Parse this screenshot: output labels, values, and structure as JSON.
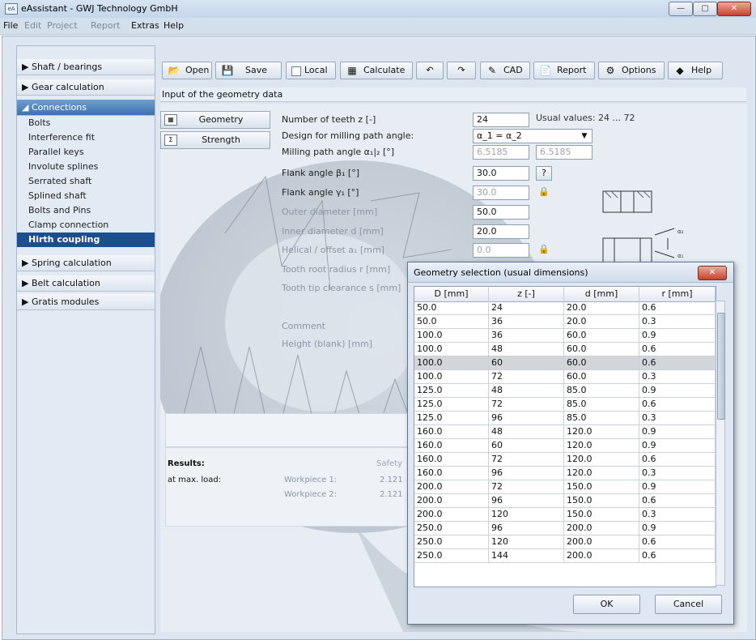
{
  "window": {
    "title": "eAssistant - GWJ Technology GmbH",
    "app_icon": "eA",
    "minimize_glyph": "—",
    "maximize_glyph": "▢",
    "close_glyph": "✕"
  },
  "menu": [
    {
      "label": "File",
      "enabled": true
    },
    {
      "label": "Edit",
      "enabled": false
    },
    {
      "label": "Project",
      "enabled": false
    },
    {
      "label": "Report",
      "enabled": false
    },
    {
      "label": "Extras",
      "enabled": true
    },
    {
      "label": "Help",
      "enabled": true
    }
  ],
  "sidebar": {
    "groups": [
      {
        "label": "▶ Shaft / bearings"
      },
      {
        "label": "▶ Gear calculation"
      },
      {
        "label": "◢ Connections"
      },
      {
        "label": "▶ Spring calculation"
      },
      {
        "label": "▶ Belt calculation"
      },
      {
        "label": "▶ Gratis modules"
      }
    ],
    "connection_items": [
      {
        "label": "Bolts"
      },
      {
        "label": "Interference fit"
      },
      {
        "label": "Parallel keys"
      },
      {
        "label": "Involute splines"
      },
      {
        "label": "Serrated shaft"
      },
      {
        "label": "Splined shaft"
      },
      {
        "label": "Bolts and Pins"
      },
      {
        "label": "Clamp connection"
      },
      {
        "label": "Hirth coupling",
        "selected": true
      }
    ]
  },
  "toolbar": {
    "open": "Open",
    "save": "Save",
    "local": "Local",
    "calculate": "Calculate",
    "undo_glyph": "↶",
    "redo_glyph": "↷",
    "cad": "CAD",
    "report": "Report",
    "options": "Options",
    "help": "Help",
    "icons": {
      "open": "📂",
      "save": "💾",
      "calculate": "▦",
      "cad": "✎",
      "report": "📄",
      "options": "⚙",
      "help": "◆"
    }
  },
  "section_title": "Input of the geometry data",
  "tabs": {
    "geometry": "Geometry",
    "strength": "Strength",
    "geometry_icon": "▦",
    "strength_icon": "Σ"
  },
  "form": {
    "teeth_label": "Number of teeth z [-]",
    "teeth_value": "24",
    "usual_values": "Usual values: 24 ... 72",
    "design_label": "Design for milling path angle:",
    "design_value": "α_1 = α_2",
    "milling_label": "Milling path angle α₁|₂ [°]",
    "milling_value_1": "6.5185",
    "milling_value_2": "6.5185",
    "flank_beta_label": "Flank angle β₁ [°]",
    "flank_beta_value": "30.0",
    "flank_gamma_label": "Flank angle γ₁ [°]",
    "flank_gamma_value": "30.0",
    "outer_label": "Outer diameter [mm]",
    "outer_value": "50.0",
    "inner_label": "Inner diameter d [mm]",
    "inner_value": "20.0",
    "helical_label": "Helical / offset a₁ [mm]",
    "helical_value": "0.0",
    "root_label": "Tooth root radius r [mm]",
    "tip_label": "Tooth tip clearance s [mm]",
    "comment_label": "Comment",
    "height_label": "Height (blank) [mm]",
    "question_glyph": "?",
    "lock_glyph": "🔒"
  },
  "results": {
    "label": "Results:",
    "max_load": "at max. load:",
    "safety": "Safety",
    "workpiece1": "Workpiece 1:",
    "workpiece2": "Workpiece 2:",
    "wp1_value": "2.121",
    "wp2_value": "2.121"
  },
  "dialog": {
    "title": "Geometry selection (usual dimensions)",
    "close_glyph": "✕",
    "columns": [
      "D [mm]",
      "z [-]",
      "d [mm]",
      "r [mm]"
    ],
    "rows": [
      [
        "50.0",
        "24",
        "20.0",
        "0.6"
      ],
      [
        "50.0",
        "36",
        "20.0",
        "0.3"
      ],
      [
        "100.0",
        "36",
        "60.0",
        "0.9"
      ],
      [
        "100.0",
        "48",
        "60.0",
        "0.6"
      ],
      [
        "100.0",
        "60",
        "60.0",
        "0.6"
      ],
      [
        "100.0",
        "72",
        "60.0",
        "0.3"
      ],
      [
        "125.0",
        "48",
        "85.0",
        "0.9"
      ],
      [
        "125.0",
        "72",
        "85.0",
        "0.6"
      ],
      [
        "125.0",
        "96",
        "85.0",
        "0.3"
      ],
      [
        "160.0",
        "48",
        "120.0",
        "0.9"
      ],
      [
        "160.0",
        "60",
        "120.0",
        "0.9"
      ],
      [
        "160.0",
        "72",
        "120.0",
        "0.6"
      ],
      [
        "160.0",
        "96",
        "120.0",
        "0.3"
      ],
      [
        "200.0",
        "72",
        "150.0",
        "0.9"
      ],
      [
        "200.0",
        "96",
        "150.0",
        "0.6"
      ],
      [
        "200.0",
        "120",
        "150.0",
        "0.3"
      ],
      [
        "250.0",
        "96",
        "200.0",
        "0.9"
      ],
      [
        "250.0",
        "120",
        "200.0",
        "0.6"
      ],
      [
        "250.0",
        "144",
        "200.0",
        "0.6"
      ]
    ],
    "selected_row": 4,
    "ok": "OK",
    "cancel": "Cancel"
  },
  "colors": {
    "accent": "#1c4f8f",
    "selection_row": "#d2d5d9",
    "close_red": "#c8412b"
  }
}
